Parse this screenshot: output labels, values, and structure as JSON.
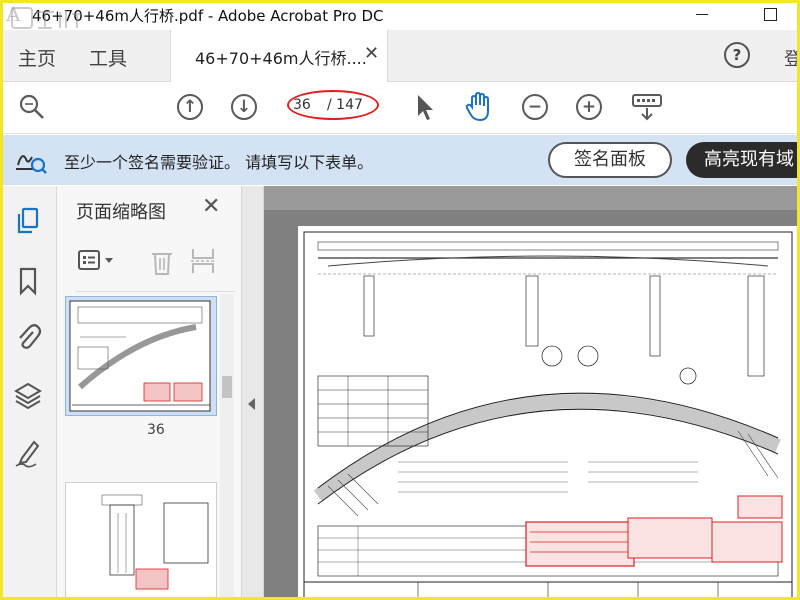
{
  "window": {
    "title": "46+70+46m人行桥.pdf - Adobe Acrobat Pro DC",
    "watermark": "土木在线"
  },
  "tabs": {
    "home": "主页",
    "tools": "工具",
    "document": "46+70+46m人行桥....",
    "login": "登"
  },
  "toolbar": {
    "current_page": "36",
    "total_pages": "/ 147",
    "zoom_out_symbol": "−",
    "zoom_in_symbol": "+",
    "prev_symbol": "↑",
    "next_symbol": "↓"
  },
  "banner": {
    "message": "至少一个签名需要验证。 请填写以下表单。",
    "sig_panel_button": "签名面板",
    "highlight_button": "高亮现有域"
  },
  "thumbnails": {
    "panel_title": "页面缩略图",
    "pages": [
      {
        "label": "36",
        "selected": true
      },
      {
        "label": "",
        "selected": false
      }
    ]
  },
  "colors": {
    "annotation_oval": "#e02020",
    "banner_bg": "#d4e3f4",
    "accent_blue": "#1a73c8",
    "stamp_red": "#d22"
  },
  "icons": [
    "zoom-search-icon",
    "page-up-icon",
    "page-down-icon",
    "select-cursor-icon",
    "hand-tool-icon",
    "zoom-out-icon",
    "zoom-in-icon",
    "keyboard-icon",
    "signature-verify-icon",
    "page-thumbnails-icon",
    "bookmark-icon",
    "attachment-icon",
    "layers-icon",
    "sign-pen-icon"
  ]
}
